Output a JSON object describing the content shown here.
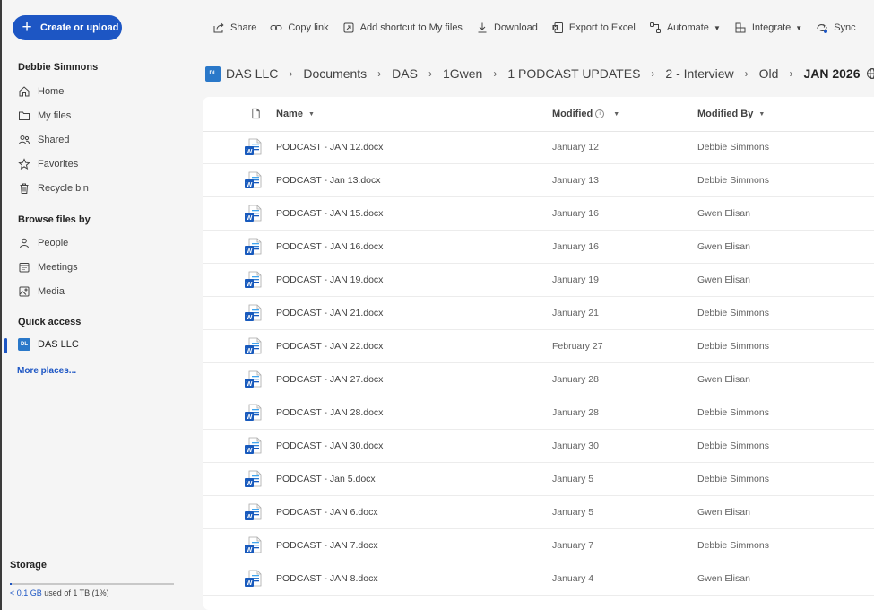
{
  "sidebar": {
    "create_label": "Create or upload",
    "user_name": "Debbie Simmons",
    "items": [
      {
        "label": "Home",
        "icon": "home-icon"
      },
      {
        "label": "My files",
        "icon": "folder-icon"
      },
      {
        "label": "Shared",
        "icon": "people-icon"
      },
      {
        "label": "Favorites",
        "icon": "star-icon"
      },
      {
        "label": "Recycle bin",
        "icon": "trash-icon"
      }
    ],
    "browse_title": "Browse files by",
    "browse_items": [
      {
        "label": "People",
        "icon": "person-icon"
      },
      {
        "label": "Meetings",
        "icon": "calendar-icon"
      },
      {
        "label": "Media",
        "icon": "image-icon"
      }
    ],
    "quick_access_title": "Quick access",
    "quick_access_item": {
      "badge": "DL",
      "label": "DAS LLC"
    },
    "more_places": "More places...",
    "storage_title": "Storage",
    "storage_used": "< 0.1 GB",
    "storage_rest": "used of 1 TB (1%)",
    "storage_fraction": 0.01
  },
  "toolbar": {
    "share": "Share",
    "copy_link": "Copy link",
    "add_shortcut": "Add shortcut to My files",
    "download": "Download",
    "export": "Export to Excel",
    "automate": "Automate",
    "integrate": "Integrate",
    "sync": "Sync"
  },
  "breadcrumb": {
    "badge": "DL",
    "items": [
      "DAS LLC",
      "Documents",
      "DAS",
      "1Gwen",
      "1 PODCAST UPDATES",
      "2 - Interview",
      "Old"
    ],
    "current": "JAN 2026"
  },
  "columns": {
    "name": "Name",
    "modified": "Modified",
    "modified_by": "Modified By"
  },
  "files": [
    {
      "name": "PODCAST - JAN 12.docx",
      "modified": "January 12",
      "by": "Debbie Simmons"
    },
    {
      "name": "PODCAST - Jan 13.docx",
      "modified": "January 13",
      "by": "Debbie Simmons"
    },
    {
      "name": "PODCAST - JAN 15.docx",
      "modified": "January 16",
      "by": "Gwen Elisan"
    },
    {
      "name": "PODCAST - JAN 16.docx",
      "modified": "January 16",
      "by": "Gwen Elisan"
    },
    {
      "name": "PODCAST - JAN 19.docx",
      "modified": "January 19",
      "by": "Gwen Elisan"
    },
    {
      "name": "PODCAST - JAN 21.docx",
      "modified": "January 21",
      "by": "Debbie Simmons"
    },
    {
      "name": "PODCAST - JAN 22.docx",
      "modified": "February 27",
      "by": "Debbie Simmons"
    },
    {
      "name": "PODCAST - JAN 27.docx",
      "modified": "January 28",
      "by": "Gwen Elisan"
    },
    {
      "name": "PODCAST - JAN 28.docx",
      "modified": "January 28",
      "by": "Debbie Simmons"
    },
    {
      "name": "PODCAST - JAN 30.docx",
      "modified": "January 30",
      "by": "Debbie Simmons"
    },
    {
      "name": "PODCAST - Jan 5.docx",
      "modified": "January 5",
      "by": "Debbie Simmons"
    },
    {
      "name": "PODCAST - JAN 6.docx",
      "modified": "January 5",
      "by": "Gwen Elisan"
    },
    {
      "name": "PODCAST - JAN 7.docx",
      "modified": "January 7",
      "by": "Debbie Simmons"
    },
    {
      "name": "PODCAST - JAN 8.docx",
      "modified": "January 4",
      "by": "Gwen Elisan"
    }
  ],
  "colors": {
    "accent": "#1d56c4",
    "word_blue": "#185abd"
  }
}
